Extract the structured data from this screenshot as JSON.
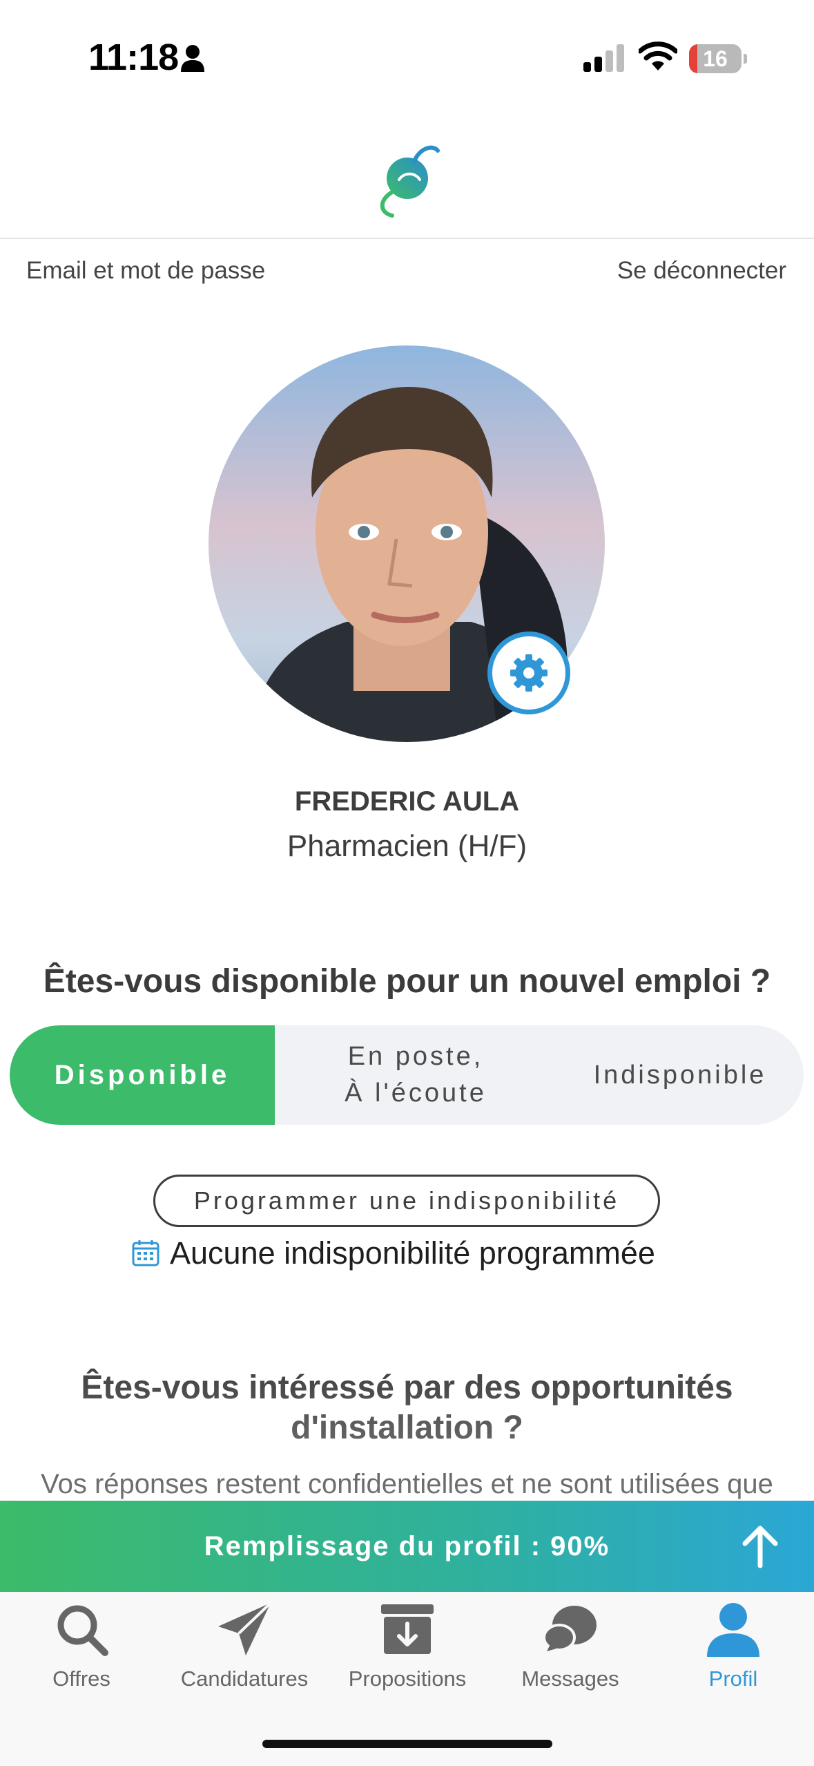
{
  "status_bar": {
    "time": "11:18",
    "battery": "16"
  },
  "header": {
    "left_link": "Email et mot de passe",
    "right_link": "Se déconnecter"
  },
  "profile": {
    "name": "FREDERIC AULA",
    "job": "Pharmacien (H/F)"
  },
  "availability": {
    "question": "Êtes-vous disponible pour un nouvel emploi ?",
    "options": [
      "Disponible",
      "En poste,\nÀ l'écoute",
      "Indisponible"
    ],
    "selected": "Disponible",
    "schedule_button": "Programmer une indisponibilité",
    "scheduled_status": "Aucune indisponibilité programmée"
  },
  "opportunities": {
    "question": "Êtes-vous intéressé par des opportunités d'installation ?",
    "note": "Vos réponses restent confidentielles et ne sont utilisées que"
  },
  "progress": {
    "label": "Remplissage du profil : 90%",
    "percent": 90
  },
  "tabs": [
    {
      "label": "Offres",
      "icon": "search-icon"
    },
    {
      "label": "Candidatures",
      "icon": "paper-plane-icon"
    },
    {
      "label": "Propositions",
      "icon": "archive-download-icon"
    },
    {
      "label": "Messages",
      "icon": "chat-bubbles-icon"
    },
    {
      "label": "Profil",
      "icon": "user-icon"
    }
  ],
  "colors": {
    "accent_green": "#3cbb6a",
    "accent_blue": "#2f97d8"
  }
}
